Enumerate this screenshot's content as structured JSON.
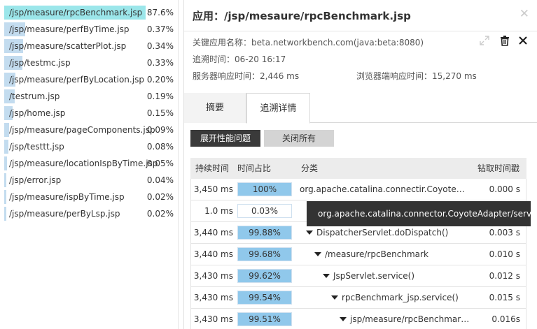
{
  "left_panel": {
    "transactions": [
      {
        "name": "/jsp/measure/rpcBenchmark.jsp",
        "pct": "87.6%",
        "share": 0.876
      },
      {
        "name": "/jsp/measure/perfByTime.jsp",
        "pct": "0.37%",
        "share": 0.0037
      },
      {
        "name": "/jsp/measure/scatterPlot.jsp",
        "pct": "0.34%",
        "share": 0.0034
      },
      {
        "name": "/jsp/testmc.jsp",
        "pct": "0.33%",
        "share": 0.0033
      },
      {
        "name": "/jsp/measure/perfByLocation.jsp",
        "pct": "0.20%",
        "share": 0.002
      },
      {
        "name": "/testrum.jsp",
        "pct": "0.19%",
        "share": 0.0019
      },
      {
        "name": "/jsp/home.jsp",
        "pct": "0.15%",
        "share": 0.0015
      },
      {
        "name": "/jsp/measure/pageComponents.jsp",
        "pct": "0.09%",
        "share": 0.0009
      },
      {
        "name": "/jsp/testtt.jsp",
        "pct": "0.08%",
        "share": 0.0008
      },
      {
        "name": "/jsp/measure/locationIspByTime.jsp",
        "pct": "0.05%",
        "share": 0.0005
      },
      {
        "name": "/jsp/error.jsp",
        "pct": "0.04%",
        "share": 0.0004
      },
      {
        "name": "/jsp/measure/ispByTime.jsp",
        "pct": "0.02%",
        "share": 0.0002
      },
      {
        "name": "/jsp/measure/perByLsp.jsp",
        "pct": "0.02%",
        "share": 0.0002
      }
    ]
  },
  "header": {
    "title": "应用：/jsp/mesaure/rpcBenchmark.jsp",
    "close_glyph": "✕"
  },
  "info": {
    "app_label": "关键应用名称：",
    "app_value": "beta.networkbench.com(java:beta:8080)",
    "trace_label": "追溯时间：",
    "trace_value": "06-20 16:17",
    "server_label": "服务器响应时间：",
    "server_value": "2,446 ms",
    "browser_label": "浏览器端响应时间：",
    "browser_value": "15,270 ms"
  },
  "icons": {
    "expand": "expand-icon",
    "delete": "trash-icon",
    "close": "close-icon"
  },
  "tabs": [
    {
      "label": "摘要",
      "active": false
    },
    {
      "label": "追溯详情",
      "active": true
    }
  ],
  "buttons": {
    "expand_issues": "展开性能问题",
    "close_all": "关闭所有"
  },
  "table": {
    "headers": {
      "duration": "持续时间",
      "ratio": "时间占比",
      "category": "分类",
      "timestamp": "钻取时间戳"
    },
    "rows": [
      {
        "duration": "3,450 ms",
        "ratio": "100%",
        "ratio_value": 1.0,
        "category": "org.apache.catalina.connectir.CoyoteAdap...",
        "expanded": false,
        "indent": 0,
        "time": "0.000 s"
      },
      {
        "duration": "1.0 ms",
        "ratio": "0.03%",
        "ratio_value": 0.0003,
        "category": "",
        "expanded": false,
        "indent": 0,
        "time": ""
      },
      {
        "duration": "3,440 ms",
        "ratio": "99.88%",
        "ratio_value": 0.9988,
        "category": "DispatcherServlet.doDispatch()",
        "expanded": true,
        "indent": 1,
        "time": "0.003 s"
      },
      {
        "duration": "3,440 ms",
        "ratio": "99.68%",
        "ratio_value": 0.9968,
        "category": "/measure/rpcBenchmark",
        "expanded": true,
        "indent": 2,
        "time": "0.010 s"
      },
      {
        "duration": "3,430 ms",
        "ratio": "99.62%",
        "ratio_value": 0.9962,
        "category": "JspServlet.service()",
        "expanded": true,
        "indent": 3,
        "time": "0.012 s"
      },
      {
        "duration": "3,430 ms",
        "ratio": "99.54%",
        "ratio_value": 0.9954,
        "category": "rpcBenchmark_jsp.service()",
        "expanded": true,
        "indent": 4,
        "time": "0.015 s"
      },
      {
        "duration": "3,430 ms",
        "ratio": "99.51%",
        "ratio_value": 0.9951,
        "category": "jsp/measure/rpcBenchmark.jsp",
        "expanded": true,
        "indent": 5,
        "time": "0.016s"
      }
    ]
  },
  "tooltip": {
    "text": "org.apache.catalina.connector.CoyoteAdapter/service"
  },
  "colors": {
    "top_bar": "#9be6ea",
    "small_bar": "#c3dcef",
    "ratio_fill": "#90c8eb",
    "dark_button": "#3a3a3a"
  }
}
